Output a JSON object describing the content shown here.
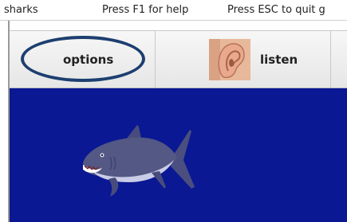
{
  "titlebar": {
    "app_name": "sharks",
    "help_hint": "Press F1 for help",
    "quit_hint": "Press ESC to quit g"
  },
  "toolbar": {
    "options_label": "options",
    "listen_label": "listen",
    "listen_icon": "ear-icon"
  },
  "stage": {
    "background_color": "#0a1893",
    "sprite": "shark-icon"
  },
  "colors": {
    "highlight_circle": "#1d3f70"
  }
}
